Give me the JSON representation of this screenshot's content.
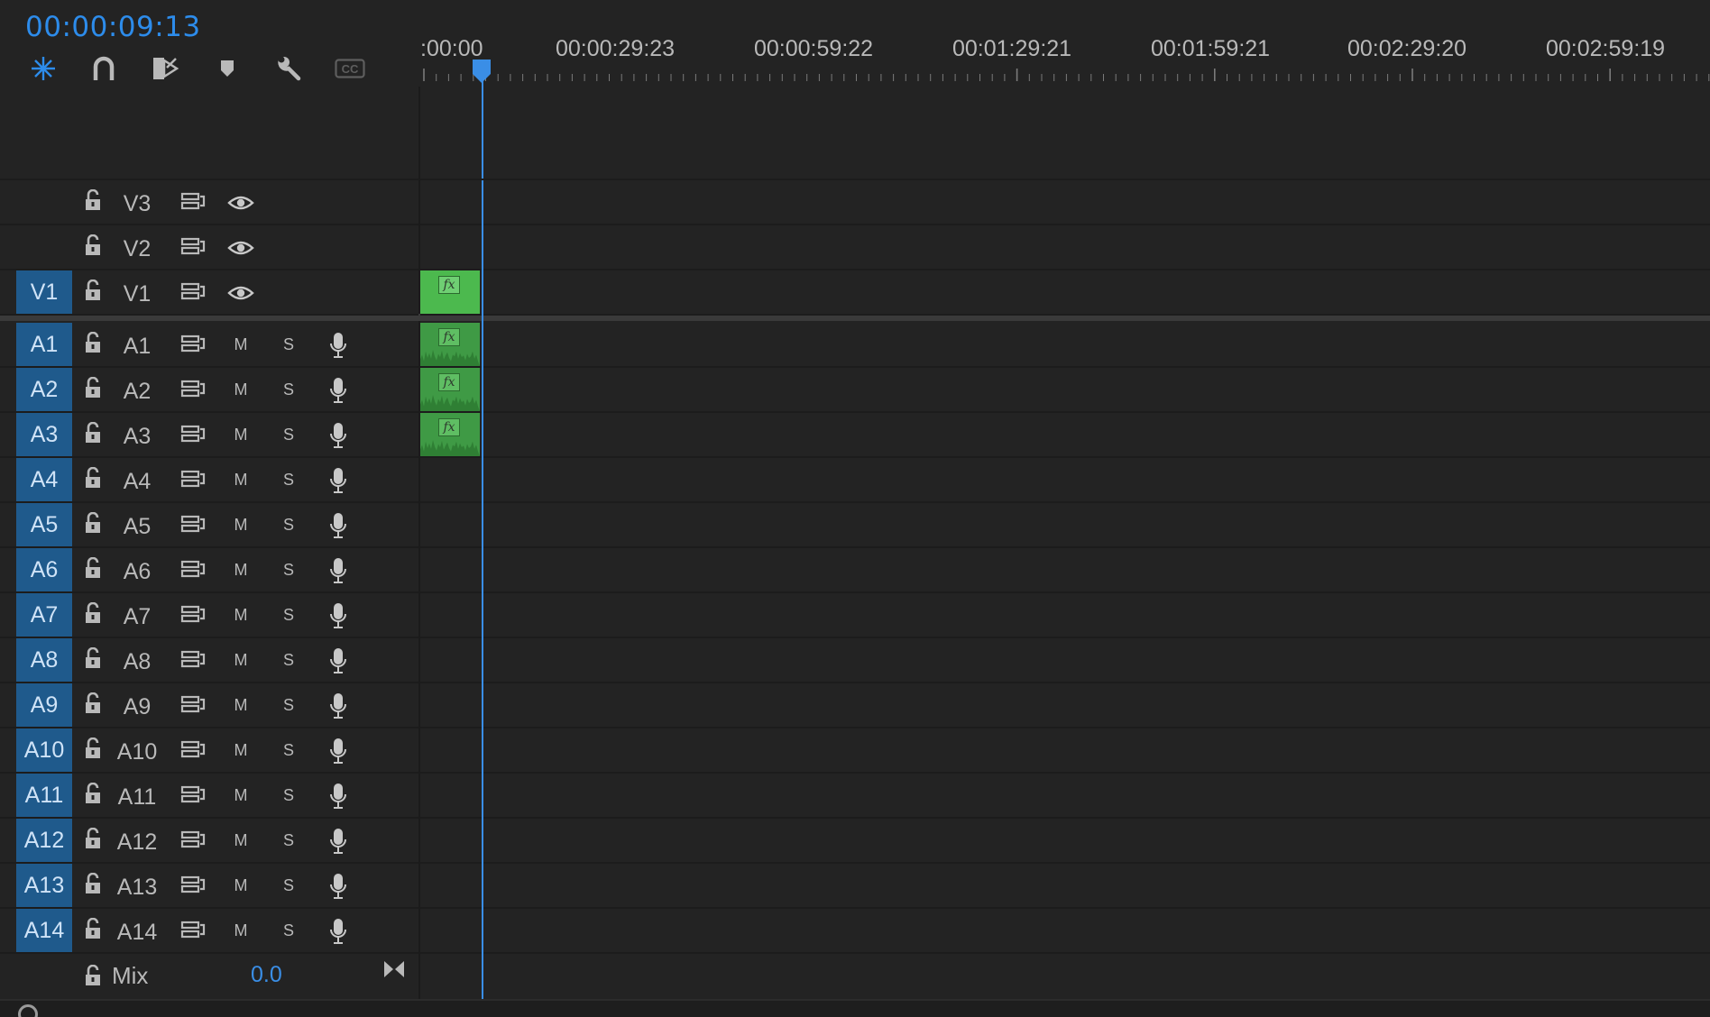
{
  "sequence": {
    "timecode": "00:00:09:13"
  },
  "toolbar": {
    "items": [
      {
        "name": "insert-overwrite-icon",
        "active": true
      },
      {
        "name": "snap-icon"
      },
      {
        "name": "linked-selection-icon"
      },
      {
        "name": "add-marker-icon"
      },
      {
        "name": "timeline-settings-icon"
      },
      {
        "name": "captions-icon",
        "label": "CC"
      }
    ]
  },
  "ruler": {
    "labels": [
      ":00:00",
      "00:00:29:23",
      "00:00:59:22",
      "00:01:29:21",
      "00:01:59:21",
      "00:02:29:20",
      "00:02:59:19"
    ]
  },
  "video_tracks": [
    {
      "patch": "",
      "name": "V3"
    },
    {
      "patch": "",
      "name": "V2"
    },
    {
      "patch": "V1",
      "name": "V1",
      "clip": true
    }
  ],
  "audio_tracks": [
    {
      "patch": "A1",
      "name": "A1",
      "clip": true
    },
    {
      "patch": "A2",
      "name": "A2",
      "clip": true
    },
    {
      "patch": "A3",
      "name": "A3",
      "clip": true
    },
    {
      "patch": "A4",
      "name": "A4"
    },
    {
      "patch": "A5",
      "name": "A5"
    },
    {
      "patch": "A6",
      "name": "A6"
    },
    {
      "patch": "A7",
      "name": "A7"
    },
    {
      "patch": "A8",
      "name": "A8"
    },
    {
      "patch": "A9",
      "name": "A9"
    },
    {
      "patch": "A10",
      "name": "A10"
    },
    {
      "patch": "A11",
      "name": "A11"
    },
    {
      "patch": "A12",
      "name": "A12"
    },
    {
      "patch": "A13",
      "name": "A13"
    },
    {
      "patch": "A14",
      "name": "A14"
    }
  ],
  "audio_buttons": {
    "mute": "M",
    "solo": "S"
  },
  "clip_badge": "fx",
  "mix": {
    "label": "Mix",
    "value": "0.0"
  },
  "colors": {
    "accent": "#2d8ceb",
    "patch": "#1f5a8c",
    "video_clip": "#4cb94e",
    "audio_clip": "#3f9a45",
    "background": "#232323"
  }
}
